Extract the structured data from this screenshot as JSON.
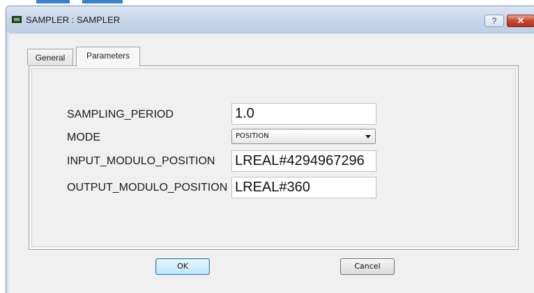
{
  "window": {
    "title": "SAMPLER : SAMPLER",
    "help_glyph": "?",
    "close_glyph": "✕"
  },
  "tabs": [
    {
      "label": "General",
      "active": false
    },
    {
      "label": "Parameters",
      "active": true
    }
  ],
  "parameters": {
    "sampling_period": {
      "label": "SAMPLING_PERIOD",
      "value": "1.0"
    },
    "mode": {
      "label": "MODE",
      "value": "POSITION"
    },
    "input_modulo_position": {
      "label": "INPUT_MODULO_POSITION",
      "value": "LREAL#4294967296"
    },
    "output_modulo_position": {
      "label": "OUTPUT_MODULO_POSITION",
      "value": "LREAL#360"
    }
  },
  "buttons": {
    "ok": "OK",
    "cancel": "Cancel"
  },
  "colors": {
    "titlebar": "#c7d7ea",
    "close_button": "#c8452f",
    "dialog_background": "#f0f0f0"
  }
}
